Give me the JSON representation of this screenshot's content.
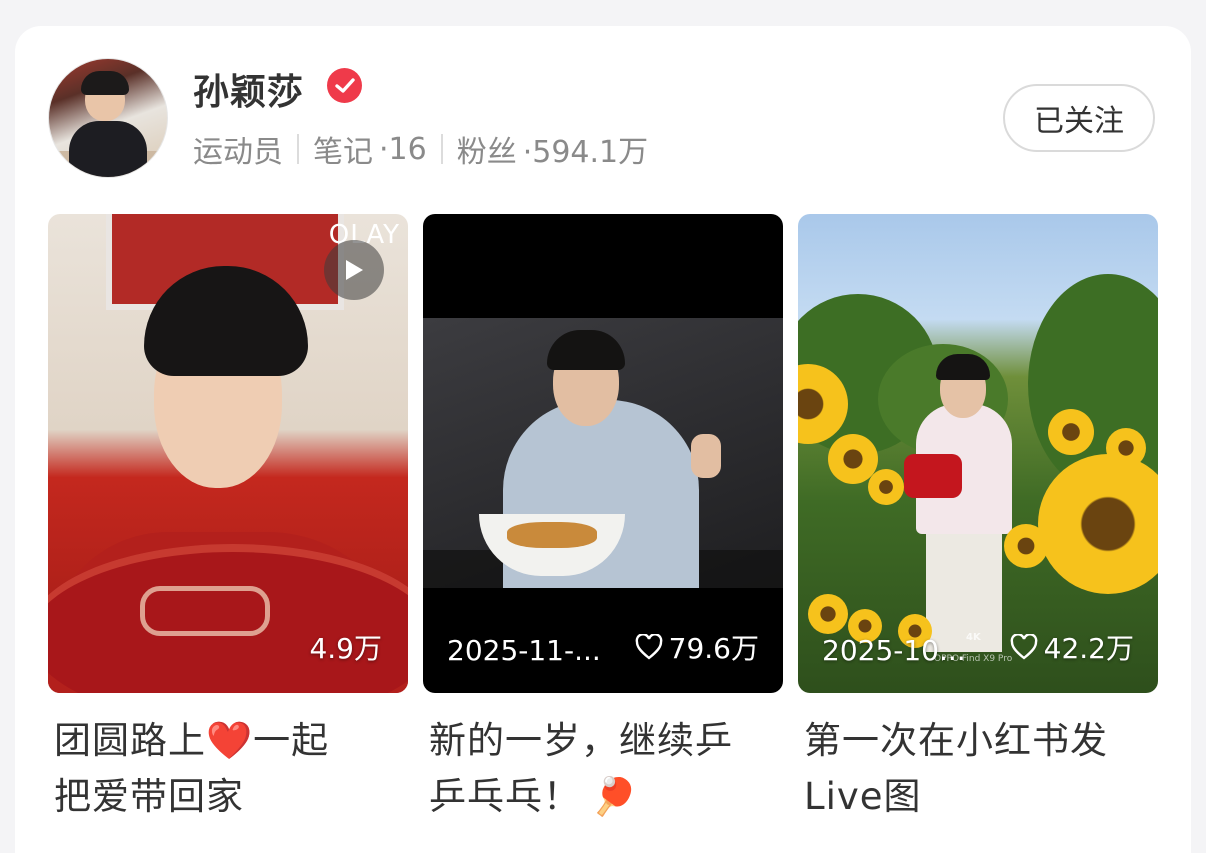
{
  "profile": {
    "name": "孙颖莎",
    "role": "运动员",
    "notes_label": "笔记",
    "notes_count": "·16",
    "fans_label": "粉丝",
    "fans_count": "·594.1万",
    "follow_button": "已关注",
    "verified": true
  },
  "colors": {
    "verified_badge": "#ef3a4a",
    "background": "#f4f4f6",
    "card": "#ffffff"
  },
  "notes": [
    {
      "title_line1": "团圆路上",
      "title_emoji": "❤️",
      "title_line1_rest": "一起",
      "title_line2": "把爱带回家",
      "likes": "4.9万",
      "is_video": true,
      "brand_text": "OLAY"
    },
    {
      "title_line1": "新的一岁，继续乒",
      "title_line2": "乒乓乓！",
      "title_emoji": "🏓",
      "date": "2025-11-...",
      "likes": "79.6万"
    },
    {
      "title_line1": "第一次在小红书发",
      "title_line2": "Live图",
      "date": "2025-10...",
      "likes": "42.2万",
      "watermark": "OPPO Find X9 Pro",
      "badge": "4K"
    }
  ]
}
